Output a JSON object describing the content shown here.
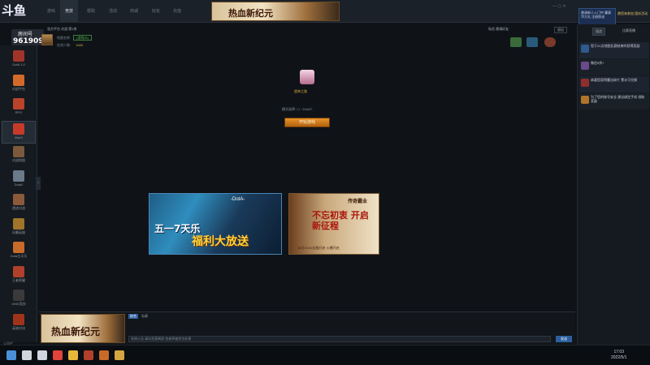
{
  "streamer": {
    "platform_logo": "斗鱼",
    "label": "房间号",
    "room_id": "9619097"
  },
  "topbar": {
    "tabs": [
      "游戏",
      "竞技",
      "帮助",
      "活动",
      "商城",
      "好友",
      "充值"
    ],
    "active_tab": 1,
    "banner": "热血新纪元",
    "window_controls": "— ▢ ✕",
    "promo_box": "邀请新人入门中 赢豪华大礼 注册即送",
    "promo_right": "邀您来参加 国庆活动"
  },
  "sidebar": {
    "games": [
      {
        "label": "DotA 1.0",
        "color": "#a0342a"
      },
      {
        "label": "对战平台",
        "color": "#d46a2a"
      },
      {
        "label": "RPG",
        "color": "#b9442a"
      },
      {
        "label": "War3",
        "color": "#c73a2a"
      },
      {
        "label": "对战地图",
        "color": "#7a5a3a"
      },
      {
        "label": "Dota2",
        "color": "#6a7a8a"
      },
      {
        "label": "遗迹对战",
        "color": "#8a5a3a"
      },
      {
        "label": "风暴英雄",
        "color": "#a0742a"
      },
      {
        "label": "Dota五天乐",
        "color": "#c76a2a"
      },
      {
        "label": "王者荣耀",
        "color": "#b0402a"
      },
      {
        "label": "OMG竞技",
        "color": "#3a3a3a"
      },
      {
        "label": "英雄对决",
        "color": "#a0341a"
      }
    ]
  },
  "room": {
    "title": "浩方平台 对战 第1房",
    "map_label": "地图名称:",
    "map_value": "(游戏ID)",
    "count_label": "在线人数:",
    "count_value": "1665",
    "buttons": "私信  邀请好友",
    "exit_label": "退出"
  },
  "main": {
    "ext_label": "超神之路",
    "mode_label": "模式选择: ☐ ~1168人",
    "start_label": "开始游戏"
  },
  "cards": {
    "card1": {
      "tag": "-DotA-",
      "line1": "五一7天乐",
      "line2": "福利大放送"
    },
    "card2": {
      "tag": "传奇霸业",
      "line": "不忘初衷 开启新征程",
      "sub": "28日19:00全服开启 火爆开启"
    }
  },
  "rightpanel": {
    "tabs": [
      "国战",
      "比赛直播"
    ],
    "messages": [
      {
        "text": "您于22点地图比赛结束时获得奖励",
        "color": "#2e5a8e"
      },
      {
        "text": "微信5折+",
        "color": "#6a4a8a"
      },
      {
        "text": "恭喜您获得魔法碎片 累计可兑换",
        "color": "#8e2e2e"
      },
      {
        "text": "为了您的账号安全 建议绑定手机 领取奖励",
        "color": "#b0742a"
      }
    ]
  },
  "chat": {
    "tabs": [
      "综合",
      "私聊"
    ],
    "input_placeholder": "系统公告:请勿恶意刷屏,违者将被禁言处理",
    "send_label": "发送"
  },
  "status_left": "公告栏",
  "clock": {
    "time": "17:03",
    "date": "2022/5/1"
  },
  "taskbar_icons": [
    {
      "name": "windows-start-icon",
      "color": "#4a90d9"
    },
    {
      "name": "search-icon",
      "color": "#cfd6de"
    },
    {
      "name": "task-view-icon",
      "color": "#cfd6de"
    },
    {
      "name": "chrome-icon",
      "color": "#e0443a"
    },
    {
      "name": "folder-icon",
      "color": "#e8b83a"
    },
    {
      "name": "app1-icon",
      "color": "#b0402a"
    },
    {
      "name": "app2-icon",
      "color": "#c76a2a"
    },
    {
      "name": "app3-icon",
      "color": "#d4a640"
    }
  ]
}
